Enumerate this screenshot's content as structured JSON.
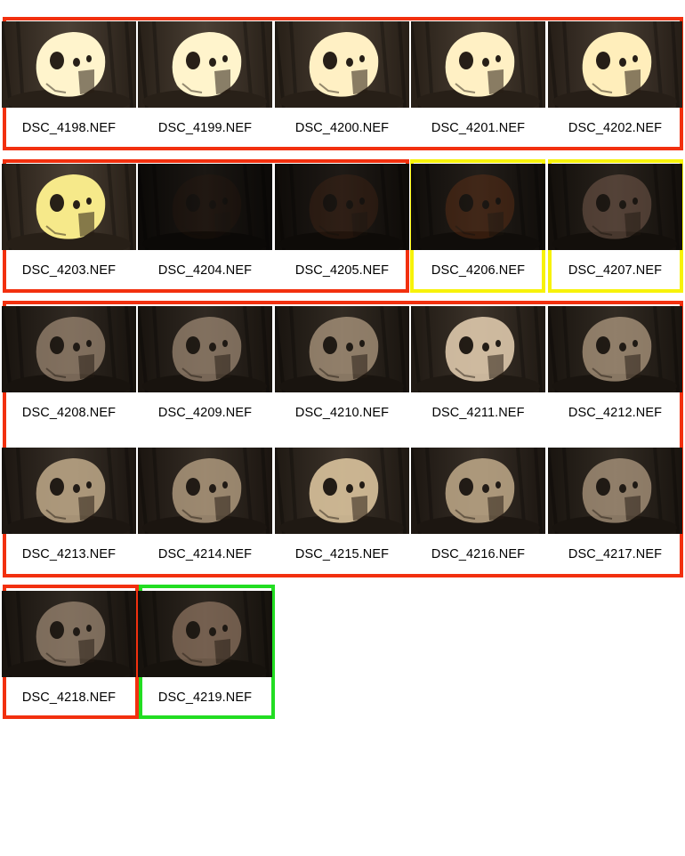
{
  "colors": {
    "red": "#f2300f",
    "yellow": "#f7f20a",
    "green": "#22dd22"
  },
  "thumbnails": [
    {
      "filename": "DSC_4198.NEF",
      "brightness": 1.0,
      "tone": "#fff4cc",
      "group": "red"
    },
    {
      "filename": "DSC_4199.NEF",
      "brightness": 1.0,
      "tone": "#fff4cc",
      "group": "red"
    },
    {
      "filename": "DSC_4200.NEF",
      "brightness": 0.95,
      "tone": "#fff0c4",
      "group": "red"
    },
    {
      "filename": "DSC_4201.NEF",
      "brightness": 0.95,
      "tone": "#fff0c4",
      "group": "red"
    },
    {
      "filename": "DSC_4202.NEF",
      "brightness": 0.92,
      "tone": "#ffeebb",
      "group": "red"
    },
    {
      "filename": "DSC_4203.NEF",
      "brightness": 0.95,
      "tone": "#f6e98a",
      "group": "red"
    },
    {
      "filename": "DSC_4204.NEF",
      "brightness": 0.04,
      "tone": "#3a1e10",
      "group": "red"
    },
    {
      "filename": "DSC_4205.NEF",
      "brightness": 0.12,
      "tone": "#5a2e18",
      "group": "red"
    },
    {
      "filename": "DSC_4206.NEF",
      "brightness": 0.2,
      "tone": "#7a3a18",
      "group": "yellow"
    },
    {
      "filename": "DSC_4207.NEF",
      "brightness": 0.3,
      "tone": "#8a6a5a",
      "group": "yellow"
    },
    {
      "filename": "DSC_4208.NEF",
      "brightness": 0.45,
      "tone": "#b8a088",
      "group": "red"
    },
    {
      "filename": "DSC_4209.NEF",
      "brightness": 0.45,
      "tone": "#b8a088",
      "group": "red"
    },
    {
      "filename": "DSC_4210.NEF",
      "brightness": 0.5,
      "tone": "#c4ac90",
      "group": "red"
    },
    {
      "filename": "DSC_4211.NEF",
      "brightness": 0.7,
      "tone": "#e8d2b4",
      "group": "red"
    },
    {
      "filename": "DSC_4212.NEF",
      "brightness": 0.5,
      "tone": "#c4ac90",
      "group": "red"
    },
    {
      "filename": "DSC_4213.NEF",
      "brightness": 0.6,
      "tone": "#d4bc98",
      "group": "red"
    },
    {
      "filename": "DSC_4214.NEF",
      "brightness": 0.55,
      "tone": "#c8b090",
      "group": "red"
    },
    {
      "filename": "DSC_4215.NEF",
      "brightness": 0.7,
      "tone": "#e4cca4",
      "group": "red"
    },
    {
      "filename": "DSC_4216.NEF",
      "brightness": 0.6,
      "tone": "#d4bc98",
      "group": "red"
    },
    {
      "filename": "DSC_4217.NEF",
      "brightness": 0.5,
      "tone": "#c4ac90",
      "group": "red"
    },
    {
      "filename": "DSC_4218.NEF",
      "brightness": 0.45,
      "tone": "#b8a088",
      "group": "red"
    },
    {
      "filename": "DSC_4219.NEF",
      "brightness": 0.4,
      "tone": "#b09078",
      "group": "green"
    }
  ]
}
